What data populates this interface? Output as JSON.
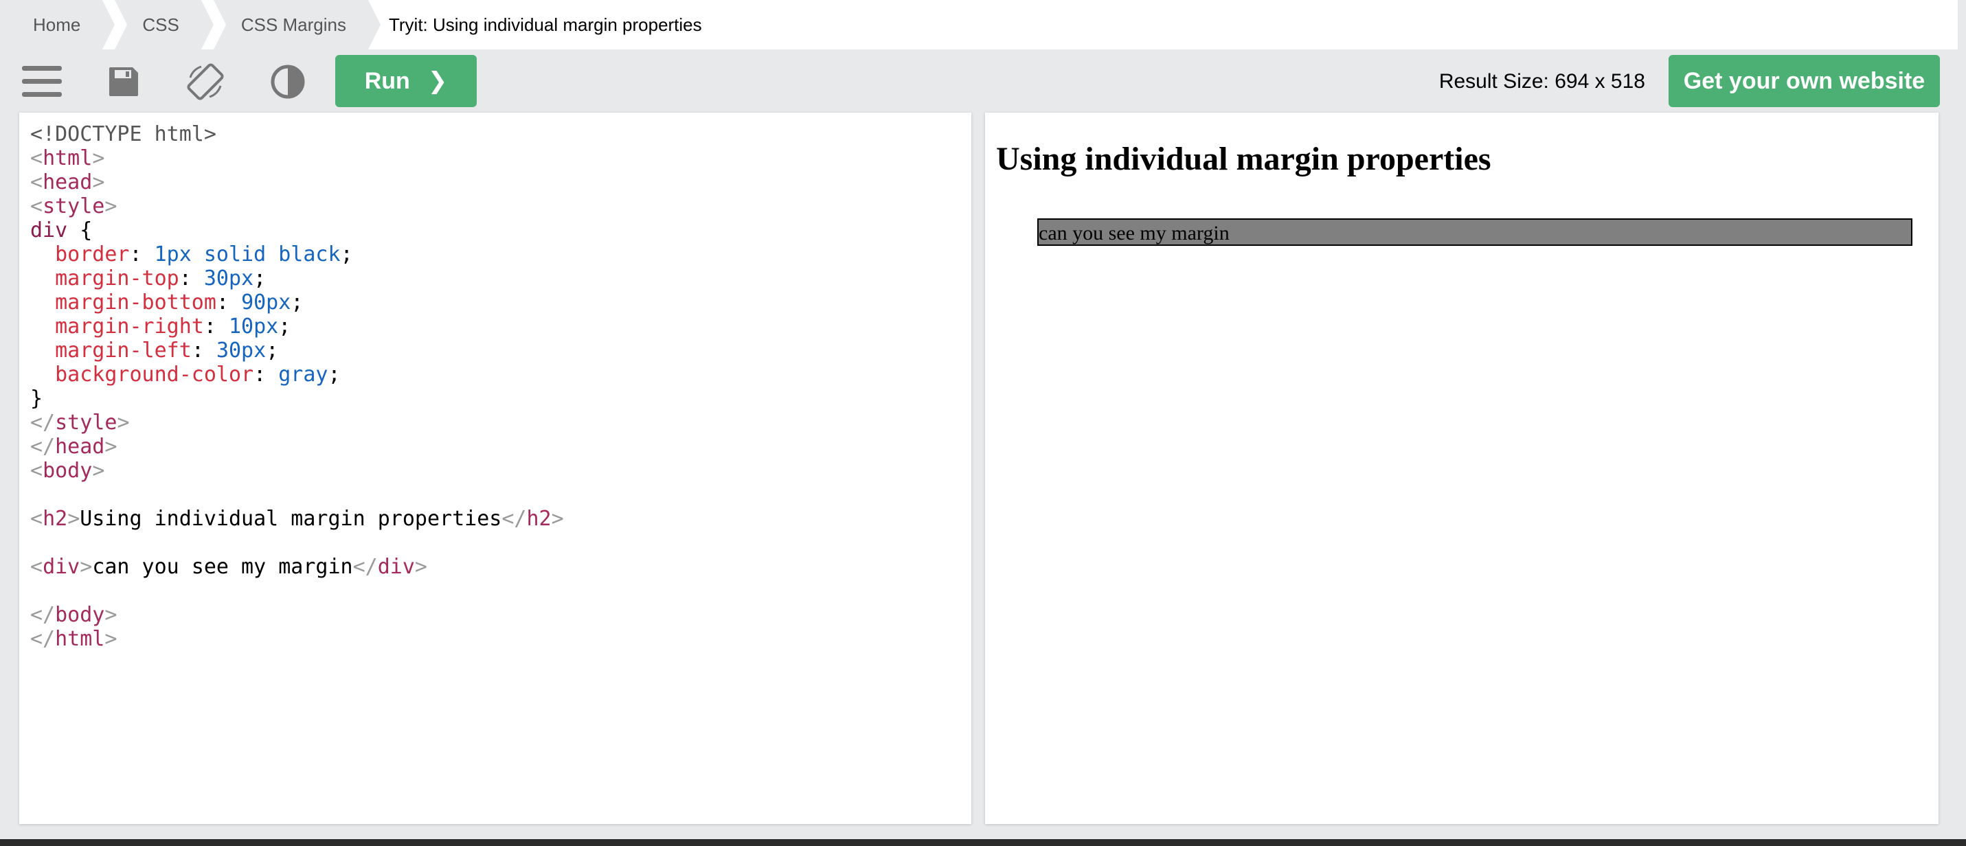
{
  "breadcrumb": {
    "items": [
      "Home",
      "CSS",
      "CSS Margins"
    ],
    "current": "Tryit: Using individual margin properties"
  },
  "toolbar": {
    "icons": [
      "menu-icon",
      "save-icon",
      "rotate-icon",
      "contrast-icon"
    ],
    "run_label": "Run",
    "run_chevron": "❯",
    "result_size": "Result Size: 694 x 518",
    "own_site_label": "Get your own website"
  },
  "colors": {
    "accent_green": "#4caf74",
    "tag": "#a52a5c",
    "property": "#d32f3e",
    "value": "#1565c0"
  },
  "editor": {
    "lines": [
      [
        {
          "t": "<!DOCTYPE html>",
          "c": "c-doc"
        }
      ],
      [
        {
          "t": "<",
          "c": "c-br"
        },
        {
          "t": "html",
          "c": "c-tag"
        },
        {
          "t": ">",
          "c": "c-br"
        }
      ],
      [
        {
          "t": "<",
          "c": "c-br"
        },
        {
          "t": "head",
          "c": "c-tag"
        },
        {
          "t": ">",
          "c": "c-br"
        }
      ],
      [
        {
          "t": "<",
          "c": "c-br"
        },
        {
          "t": "style",
          "c": "c-tag"
        },
        {
          "t": ">",
          "c": "c-br"
        }
      ],
      [
        {
          "t": "div ",
          "c": "c-tag-dk"
        },
        {
          "t": "{",
          "c": "c-txt"
        }
      ],
      [
        {
          "t": "  ",
          "c": "c-txt"
        },
        {
          "t": "border",
          "c": "c-prop"
        },
        {
          "t": ": ",
          "c": "c-txt"
        },
        {
          "t": "1px solid black",
          "c": "c-val"
        },
        {
          "t": ";",
          "c": "c-txt"
        }
      ],
      [
        {
          "t": "  ",
          "c": "c-txt"
        },
        {
          "t": "margin-top",
          "c": "c-prop"
        },
        {
          "t": ": ",
          "c": "c-txt"
        },
        {
          "t": "30px",
          "c": "c-val"
        },
        {
          "t": ";",
          "c": "c-txt"
        }
      ],
      [
        {
          "t": "  ",
          "c": "c-txt"
        },
        {
          "t": "margin-bottom",
          "c": "c-prop"
        },
        {
          "t": ": ",
          "c": "c-txt"
        },
        {
          "t": "90px",
          "c": "c-val"
        },
        {
          "t": ";",
          "c": "c-txt"
        }
      ],
      [
        {
          "t": "  ",
          "c": "c-txt"
        },
        {
          "t": "margin-right",
          "c": "c-prop"
        },
        {
          "t": ": ",
          "c": "c-txt"
        },
        {
          "t": "10px",
          "c": "c-val"
        },
        {
          "t": ";",
          "c": "c-txt"
        }
      ],
      [
        {
          "t": "  ",
          "c": "c-txt"
        },
        {
          "t": "margin-left",
          "c": "c-prop"
        },
        {
          "t": ": ",
          "c": "c-txt"
        },
        {
          "t": "30px",
          "c": "c-val"
        },
        {
          "t": ";",
          "c": "c-txt"
        }
      ],
      [
        {
          "t": "  ",
          "c": "c-txt"
        },
        {
          "t": "background-color",
          "c": "c-prop"
        },
        {
          "t": ": ",
          "c": "c-txt"
        },
        {
          "t": "gray",
          "c": "c-val"
        },
        {
          "t": ";",
          "c": "c-txt"
        }
      ],
      [
        {
          "t": "}",
          "c": "c-txt"
        }
      ],
      [
        {
          "t": "</",
          "c": "c-br"
        },
        {
          "t": "style",
          "c": "c-tag"
        },
        {
          "t": ">",
          "c": "c-br"
        }
      ],
      [
        {
          "t": "</",
          "c": "c-br"
        },
        {
          "t": "head",
          "c": "c-tag"
        },
        {
          "t": ">",
          "c": "c-br"
        }
      ],
      [
        {
          "t": "<",
          "c": "c-br"
        },
        {
          "t": "body",
          "c": "c-tag"
        },
        {
          "t": ">",
          "c": "c-br"
        }
      ],
      [],
      [
        {
          "t": "<",
          "c": "c-br"
        },
        {
          "t": "h2",
          "c": "c-tag"
        },
        {
          "t": ">",
          "c": "c-br"
        },
        {
          "t": "Using individual margin properties",
          "c": "c-txt"
        },
        {
          "t": "</",
          "c": "c-br"
        },
        {
          "t": "h2",
          "c": "c-tag"
        },
        {
          "t": ">",
          "c": "c-br"
        }
      ],
      [],
      [
        {
          "t": "<",
          "c": "c-br"
        },
        {
          "t": "div",
          "c": "c-tag"
        },
        {
          "t": ">",
          "c": "c-br"
        },
        {
          "t": "can you see my margin",
          "c": "c-txt"
        },
        {
          "t": "</",
          "c": "c-br"
        },
        {
          "t": "div",
          "c": "c-tag"
        },
        {
          "t": ">",
          "c": "c-br"
        }
      ],
      [],
      [
        {
          "t": "</",
          "c": "c-br"
        },
        {
          "t": "body",
          "c": "c-tag"
        },
        {
          "t": ">",
          "c": "c-br"
        }
      ],
      [
        {
          "t": "</",
          "c": "c-br"
        },
        {
          "t": "html",
          "c": "c-tag"
        },
        {
          "t": ">",
          "c": "c-br"
        }
      ]
    ]
  },
  "result": {
    "heading": "Using individual margin properties",
    "div_text": "can you see my margin"
  }
}
